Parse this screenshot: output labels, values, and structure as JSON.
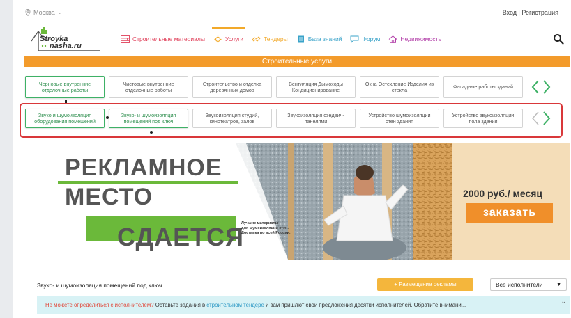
{
  "topbar": {
    "city": "Москва",
    "auth": "Вход | Регистрация"
  },
  "logo": {
    "line1": "Stroyka",
    "line2": "nasha.ru"
  },
  "menu": [
    {
      "label": "Строительные материалы",
      "color": "#e0405a",
      "icon": "brick-icon"
    },
    {
      "label": "Услуги",
      "color": "#e0405a",
      "icon": "gear-icon",
      "active": true
    },
    {
      "label": "Тендеры",
      "color": "#f2a92a",
      "icon": "handshake-icon"
    },
    {
      "label": "База знаний",
      "color": "#3aa3c9",
      "icon": "book-icon"
    },
    {
      "label": "Форум",
      "color": "#3aa3c9",
      "icon": "chat-icon"
    },
    {
      "label": "Недвижимость",
      "color": "#b23ea8",
      "icon": "house-icon"
    }
  ],
  "section_title": "Строительные услуги",
  "row1": [
    "Черновые внутренние отделочные работы",
    "Чистовые внутренние отделочные работы",
    "Строительство и отделка деревянных домов",
    "Вентиляция Дымоходы Кондиционирование",
    "Окна Остекление Изделия из стекла",
    "Фасадные работы зданий"
  ],
  "row2": [
    "Звуко и шумоизоляция оборудования помещений",
    "Звуко- и шумоизоляция помещений под ключ",
    "Звукоизоляция студий, кинотеатров, залов",
    "Звукоизоляция сэндвич-панелями",
    "Устройство шумоизоляции стен здания",
    "Устройство звукоизоляции пола здания"
  ],
  "banner": {
    "line1": "РЕКЛАМНОЕ",
    "line2": "МЕСТО",
    "line3": "СДАЕТСЯ",
    "small_lines": [
      "Лучшие материалы",
      "для шумоизоляции стен.",
      "Доставка по всей России."
    ],
    "price": "2000 руб./ месяц",
    "order": "заказать"
  },
  "footer": {
    "title": "Звуко- и шумоизоляция помещений под ключ",
    "ad_button": "+ Размещение рекламы",
    "select_value": "Все исполнители"
  },
  "notice": {
    "part1": "Не можете определиться с исполнителем?",
    "part2": " Оставьте задания в ",
    "link": "строительном тендере",
    "part3": " и вам пришлют свои предложения десятки исполнителей. Обратите внимани..."
  }
}
